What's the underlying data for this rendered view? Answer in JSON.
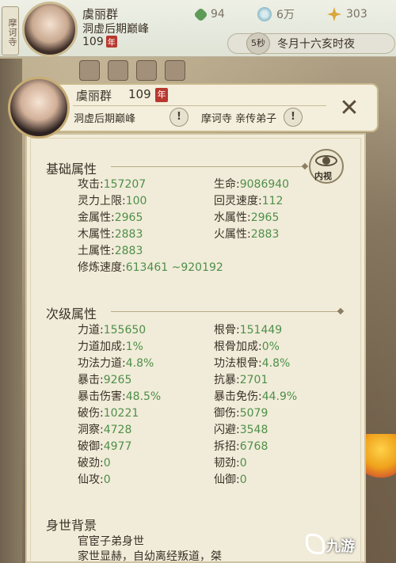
{
  "topbar": {
    "sect_tag": "摩诃寺",
    "name": "虞丽群",
    "realm": "洞虚后期巅峰",
    "age": "109",
    "age_seal": "年",
    "resources": [
      {
        "icon": "jade-leaf-icon",
        "value": "94"
      },
      {
        "icon": "spirit-stone-icon",
        "value": "6万"
      },
      {
        "icon": "gold-star-icon",
        "value": "303"
      }
    ],
    "timer": "5秒",
    "date_text": "冬月十六亥时夜"
  },
  "header": {
    "name": "虞丽群",
    "age": "109",
    "age_seal": "年",
    "realm": "洞虚后期巅峰",
    "sect_role": "摩诃寺 亲传弟子",
    "warn_symbol": "!",
    "close_symbol": "✕"
  },
  "basic": {
    "title": "基础属性",
    "inner_view": "内视",
    "rows": [
      {
        "l_label": "攻击:",
        "l_value": "157207",
        "r_label": "生命:",
        "r_value": "9086940"
      },
      {
        "l_label": "灵力上限:",
        "l_value": "100",
        "r_label": "回灵速度:",
        "r_value": "112"
      },
      {
        "l_label": "金属性:",
        "l_value": "2965",
        "r_label": "水属性:",
        "r_value": "2965"
      },
      {
        "l_label": "木属性:",
        "l_value": "2883",
        "r_label": "火属性:",
        "r_value": "2883"
      },
      {
        "l_label": "土属性:",
        "l_value": "2883"
      },
      {
        "l_label": "修炼速度:",
        "l_value": "613461 ~920192"
      }
    ]
  },
  "secondary": {
    "title": "次级属性",
    "rows": [
      {
        "l_label": "力道:",
        "l_value": "155650",
        "r_label": "根骨:",
        "r_value": "151449"
      },
      {
        "l_label": "力道加成:",
        "l_value": "1%",
        "r_label": "根骨加成:",
        "r_value": "0%"
      },
      {
        "l_label": "功法力道:",
        "l_value": "4.8%",
        "r_label": "功法根骨:",
        "r_value": "4.8%"
      },
      {
        "l_label": "暴击:",
        "l_value": "9265",
        "r_label": "抗暴:",
        "r_value": "2701"
      },
      {
        "l_label": "暴击伤害:",
        "l_value": "48.5%",
        "r_label": "暴击免伤:",
        "r_value": "44.9%"
      },
      {
        "l_label": "破伤:",
        "l_value": "10221",
        "r_label": "御伤:",
        "r_value": "5079"
      },
      {
        "l_label": "洞察:",
        "l_value": "4728",
        "r_label": "闪避:",
        "r_value": "3548"
      },
      {
        "l_label": "破御:",
        "l_value": "4977",
        "r_label": "拆招:",
        "r_value": "6768"
      },
      {
        "l_label": "破劲:",
        "l_value": "0",
        "r_label": "韧劲:",
        "r_value": "0"
      },
      {
        "l_label": "仙攻:",
        "l_value": "0",
        "r_label": "仙御:",
        "r_value": "0"
      }
    ]
  },
  "background": {
    "title": "身世背景",
    "line1": "官宦子弟身世",
    "line2": "家世显赫，自幼离经叛道，桀"
  },
  "watermark": "九游"
}
